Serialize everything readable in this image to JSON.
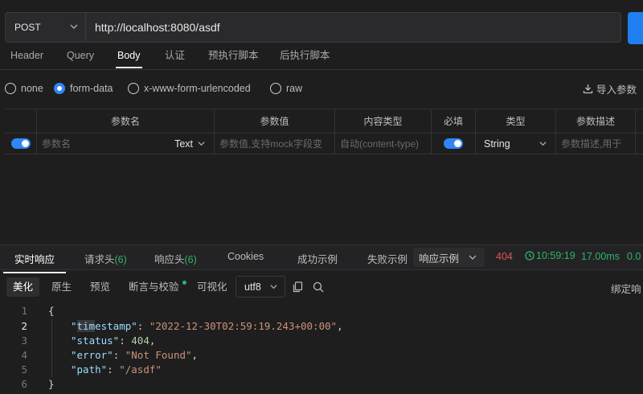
{
  "request": {
    "method": "POST",
    "url": "http://localhost:8080/asdf"
  },
  "tabs": [
    "Header",
    "Query",
    "Body",
    "认证",
    "预执行脚本",
    "后执行脚本"
  ],
  "body_types": [
    "none",
    "form-data",
    "x-www-form-urlencoded",
    "raw"
  ],
  "import_label": "导入参数",
  "table": {
    "headers": [
      "参数名",
      "参数值",
      "内容类型",
      "必填",
      "类型",
      "参数描述"
    ],
    "row": {
      "name_placeholder": "参数名",
      "param_type": "Text",
      "value_placeholder": "参数值,支持mock字段变",
      "content_type_placeholder": "自动(content-type)",
      "type": "String",
      "desc_placeholder": "参数描述,用于"
    }
  },
  "response": {
    "tabs": [
      "实时响应",
      "请求头",
      "响应头",
      "Cookies",
      "成功示例",
      "失败示例"
    ],
    "request_headers_count": "(6)",
    "response_headers_count": "(6)",
    "example_select": "响应示例",
    "status": "404",
    "time": "10:59:19",
    "duration": "17.00ms",
    "size": "0.0",
    "view_modes": [
      "美化",
      "原生",
      "预览",
      "断言与校验",
      "可视化"
    ],
    "encoding": "utf8",
    "bind_label": "绑定响",
    "line_numbers": [
      "1",
      "2",
      "3",
      "4",
      "5",
      "6"
    ],
    "json": {
      "open": "{",
      "k_timestamp_pre": "\"",
      "k_timestamp_hl": "tim",
      "k_timestamp_post": "estamp\"",
      "v_timestamp": "\"2022-12-30T02:59:19.243+00:00\"",
      "k_status": "\"status\"",
      "v_status": "404",
      "k_error": "\"error\"",
      "v_error": "\"Not Found\"",
      "k_path": "\"path\"",
      "v_path": "\"/asdf\"",
      "close": "}"
    }
  }
}
